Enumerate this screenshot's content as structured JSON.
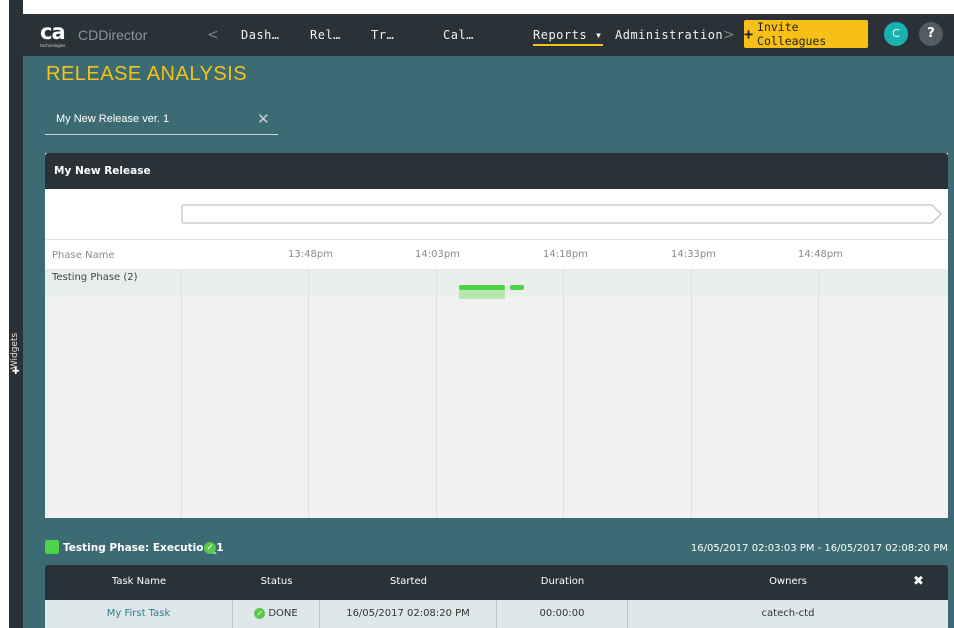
{
  "app": {
    "logo_text": "ca",
    "logo_sub": "technologies",
    "name": "CDDirector"
  },
  "nav": {
    "items": [
      "Dash…",
      "Rel…",
      "Tr…",
      "Cal…",
      "Reports",
      "Administration"
    ],
    "reports_caret": "▾",
    "invite_label": "Invite Colleagues",
    "avatar_initial": "C",
    "help": "?"
  },
  "side": {
    "widgets_label": "Widgets"
  },
  "page": {
    "title": "RELEASE ANALYSIS",
    "filter_value": "My New Release ver. 1"
  },
  "release": {
    "name": "My New Release",
    "phase_col_label": "Phase Name",
    "ticks": [
      "13:48pm",
      "14:03pm",
      "14:18pm",
      "14:33pm",
      "14:48pm"
    ],
    "rows": [
      {
        "label": "Testing Phase (2)"
      }
    ]
  },
  "phase": {
    "title": "Testing Phase: Execution_1",
    "range": "16/05/2017 02:03:03 PM - 16/05/2017 02:08:20 PM"
  },
  "tasks": {
    "headers": [
      "Task Name",
      "Status",
      "Started",
      "Duration",
      "Owners"
    ],
    "rows": [
      {
        "name": "My First Task",
        "status": "DONE",
        "started": "16/05/2017 02:08:20 PM",
        "duration": "00:00:00",
        "owners": "catech-ctd"
      }
    ]
  },
  "colors": {
    "accent": "#f2c31a",
    "nav_bg": "#2b3237",
    "page_bg": "#3c6b74",
    "bar_green": "#4cd34a",
    "bar_light": "#b8e6b0"
  }
}
